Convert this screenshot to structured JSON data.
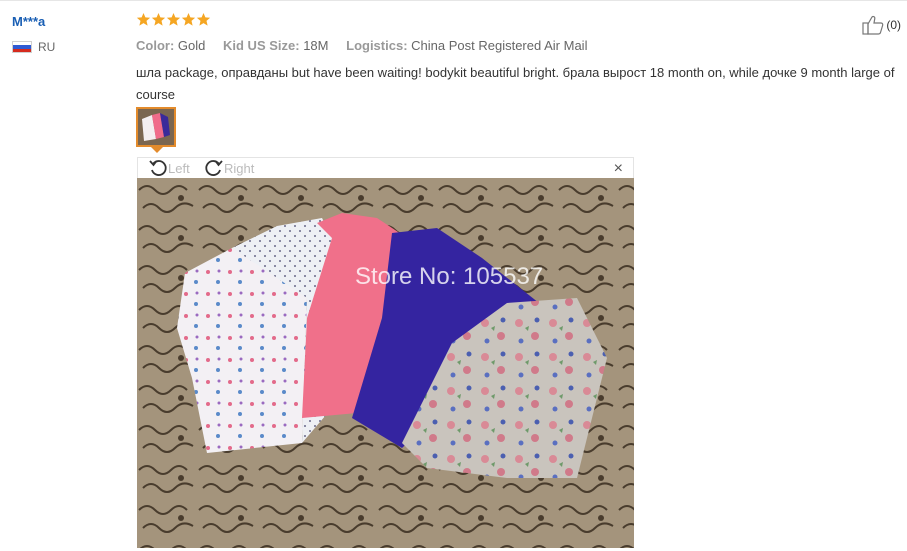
{
  "review": {
    "user_name": "M***a",
    "country_code": "RU",
    "rating": 5,
    "attributes": [
      {
        "key": "Color:",
        "value": "Gold"
      },
      {
        "key": "Kid US Size:",
        "value": "18M"
      },
      {
        "key": "Logistics:",
        "value": "China Post Registered Air Mail"
      }
    ],
    "text": "шла package, оправданы but have been waiting! bodykit beautiful bright. брала вырост 18 month on, while дочке 9 month large of course",
    "like_count": "(0)"
  },
  "viewer": {
    "rotate_left_label": "Left",
    "rotate_right_label": "Right",
    "close_label": "×",
    "watermark": "Store No: 105537"
  },
  "colors": {
    "star": "#f5a623",
    "username": "#1a5fb4",
    "thumb_border": "#e38b2c"
  }
}
